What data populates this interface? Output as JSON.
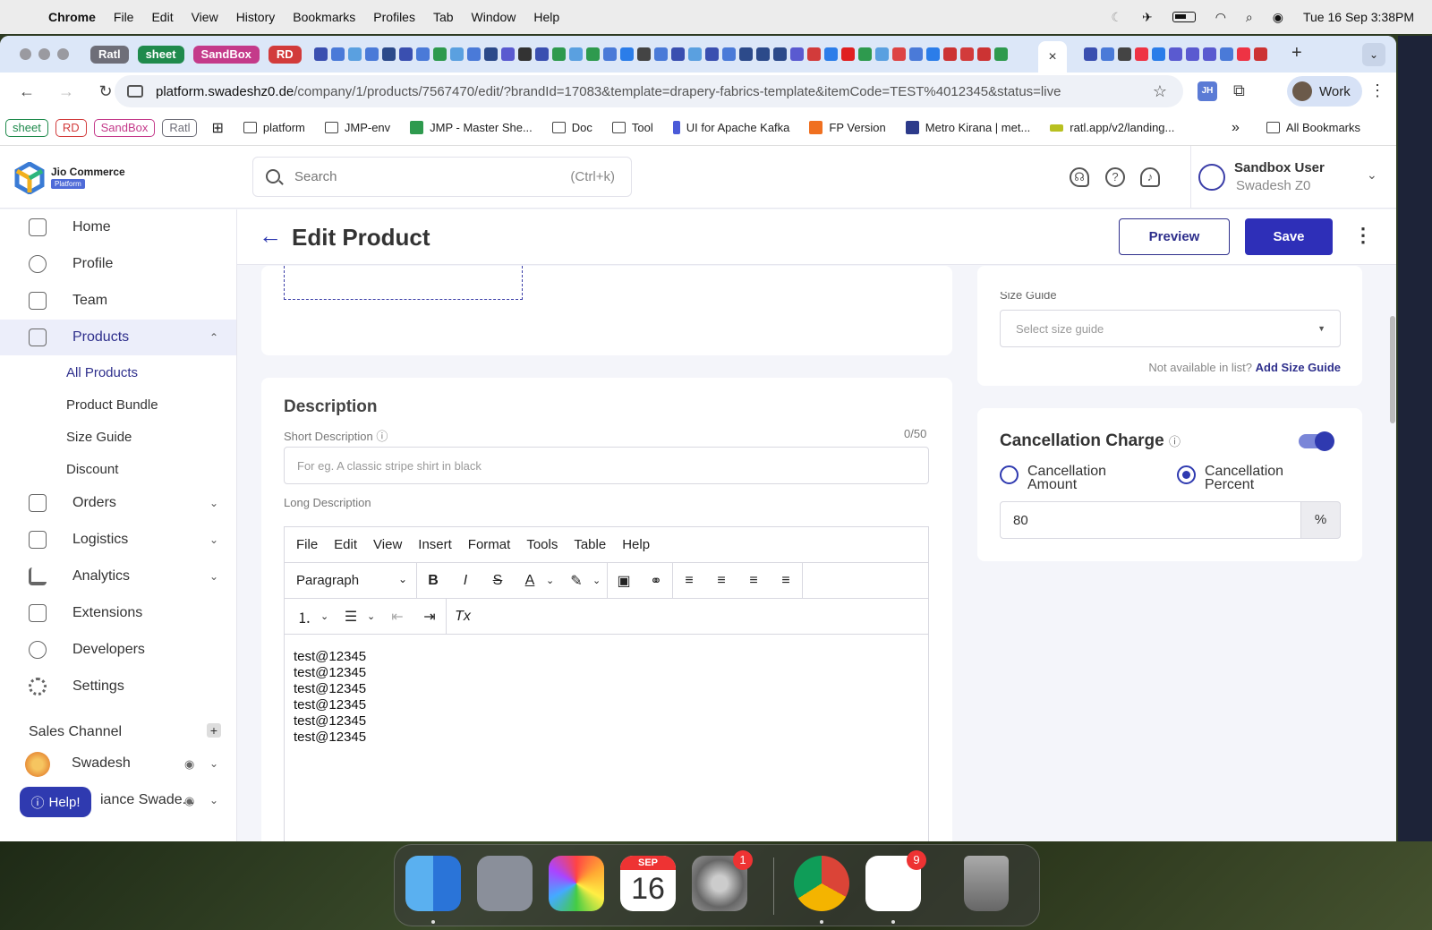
{
  "menubar": {
    "app": "Chrome",
    "items": [
      "File",
      "Edit",
      "View",
      "History",
      "Bookmarks",
      "Profiles",
      "Tab",
      "Window",
      "Help"
    ],
    "datetime": "Tue 16 Sep  3:38PM"
  },
  "tabs": {
    "groups": [
      {
        "label": "Ratl",
        "color": "#6e6e78"
      },
      {
        "label": "sheet",
        "color": "#1f8a4c"
      },
      {
        "label": "SandBox",
        "color": "#c43a8a"
      },
      {
        "label": "RD",
        "color": "#d23b3b"
      }
    ],
    "close_label": "×",
    "new_tab_label": "+"
  },
  "address": {
    "host": "platform.swadeshz0.de",
    "path": "/company/1/products/7567470/edit/?brandId=17083&template=drapery-fabrics-template&itemCode=TEST%4012345&status=live"
  },
  "profile": {
    "label": "Work",
    "ext_badge": "JH"
  },
  "bookmarks": {
    "chips": [
      {
        "label": "sheet",
        "color": "#1f8a4c"
      },
      {
        "label": "RD",
        "color": "#d23b3b"
      },
      {
        "label": "SandBox",
        "color": "#c43a8a"
      },
      {
        "label": "Ratl",
        "color": "#6e6e78"
      }
    ],
    "items": [
      "platform",
      "JMP-env",
      "JMP - Master She...",
      "Doc",
      "Tool",
      "UI for Apache Kafka",
      "FP Version",
      "Metro Kirana | met...",
      "ratl.app/v2/landing..."
    ],
    "more": "»",
    "all": "All Bookmarks"
  },
  "header": {
    "brand": "Jio Commerce",
    "brand_badge": "Platform",
    "search_placeholder": "Search",
    "search_shortcut": "(Ctrl+k)",
    "user_name": "Sandbox User",
    "user_company": "Swadesh Z0"
  },
  "sidebar": {
    "nav": [
      {
        "label": "Home",
        "icon": "home-icon"
      },
      {
        "label": "Profile",
        "icon": "profile-icon"
      },
      {
        "label": "Team",
        "icon": "team-icon"
      },
      {
        "label": "Products",
        "icon": "box-icon"
      }
    ],
    "sub": [
      "All Products",
      "Product Bundle",
      "Size Guide",
      "Discount"
    ],
    "nav2": [
      {
        "label": "Orders",
        "icon": "bag-icon"
      },
      {
        "label": "Logistics",
        "icon": "truck-icon"
      },
      {
        "label": "Analytics",
        "icon": "chart-icon"
      },
      {
        "label": "Extensions",
        "icon": "extensions-icon"
      },
      {
        "label": "Developers",
        "icon": "developers-icon"
      },
      {
        "label": "Settings",
        "icon": "settings-icon"
      }
    ],
    "sales_channel": "Sales Channel",
    "channels": [
      "Swadesh",
      "iance Swade..."
    ],
    "help": "Help!"
  },
  "page": {
    "title": "Edit Product",
    "preview": "Preview",
    "save": "Save"
  },
  "description": {
    "title": "Description",
    "short_label": "Short Description",
    "short_counter": "0/50",
    "short_placeholder": "For eg. A classic stripe shirt in black",
    "long_label": "Long Description",
    "editor_menu": [
      "File",
      "Edit",
      "View",
      "Insert",
      "Format",
      "Tools",
      "Table",
      "Help"
    ],
    "block_format": "Paragraph",
    "content_lines": [
      "test@12345",
      "test@12345",
      "test@12345",
      "test@12345",
      "test@12345",
      "test@12345"
    ]
  },
  "size_guide": {
    "label": "Size Guide",
    "placeholder": "Select size guide",
    "not_available": "Not available in list?",
    "add_link": "Add Size Guide"
  },
  "cancellation": {
    "title": "Cancellation Charge",
    "enabled": true,
    "option_amount": "Cancellation Amount",
    "option_percent": "Cancellation Percent",
    "selected": "percent",
    "value": "80",
    "unit": "%"
  },
  "dock": {
    "calendar_month": "SEP",
    "calendar_day": "16",
    "settings_badge": "1",
    "slack_badge": "9"
  }
}
